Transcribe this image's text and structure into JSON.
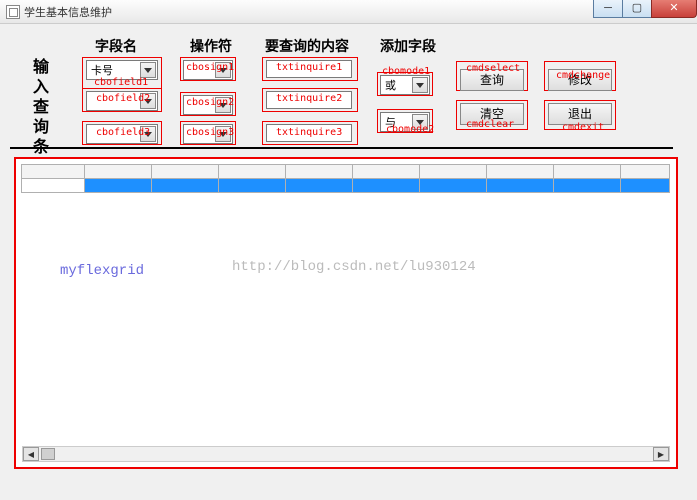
{
  "window": {
    "title": "学生基本信息维护"
  },
  "headers": {
    "field": "字段名",
    "op": "操作符",
    "content": "要查询的内容",
    "addfield": "添加字段"
  },
  "sidelabel": "输入查询条件",
  "combos": {
    "cbofield1": "卡号",
    "cbofield2": "",
    "cbofield3": "",
    "cbosign1": "",
    "cbosign2": "",
    "cbosign3": "",
    "cbomode1": "或",
    "cbomode2": "与"
  },
  "annots": {
    "cbofield1": "cbofield1",
    "cbofield2": "cbofield2",
    "cbofield3": "cbofield3",
    "cbosign1": "cbosign1",
    "cbosign2": "cbosign2",
    "cbosign3": "cbosign3",
    "txtinquire1": "txtinquire1",
    "txtinquire2": "txtinquire2",
    "txtinquire3": "txtinquire3",
    "cbomode1": "cbomode1",
    "cbomode2": "cbomode2",
    "cmdselect": "cmdselect",
    "cmdchange": "cmdchange",
    "cmdclear": "cmdclear",
    "cmdexit": "cmdexit",
    "myflexgrid": "myflexgrid"
  },
  "buttons": {
    "select": "查询",
    "change": "修改",
    "clear": "清空",
    "exit": "退出"
  },
  "watermark": "http://blog.csdn.net/lu930124",
  "chart_data": null
}
